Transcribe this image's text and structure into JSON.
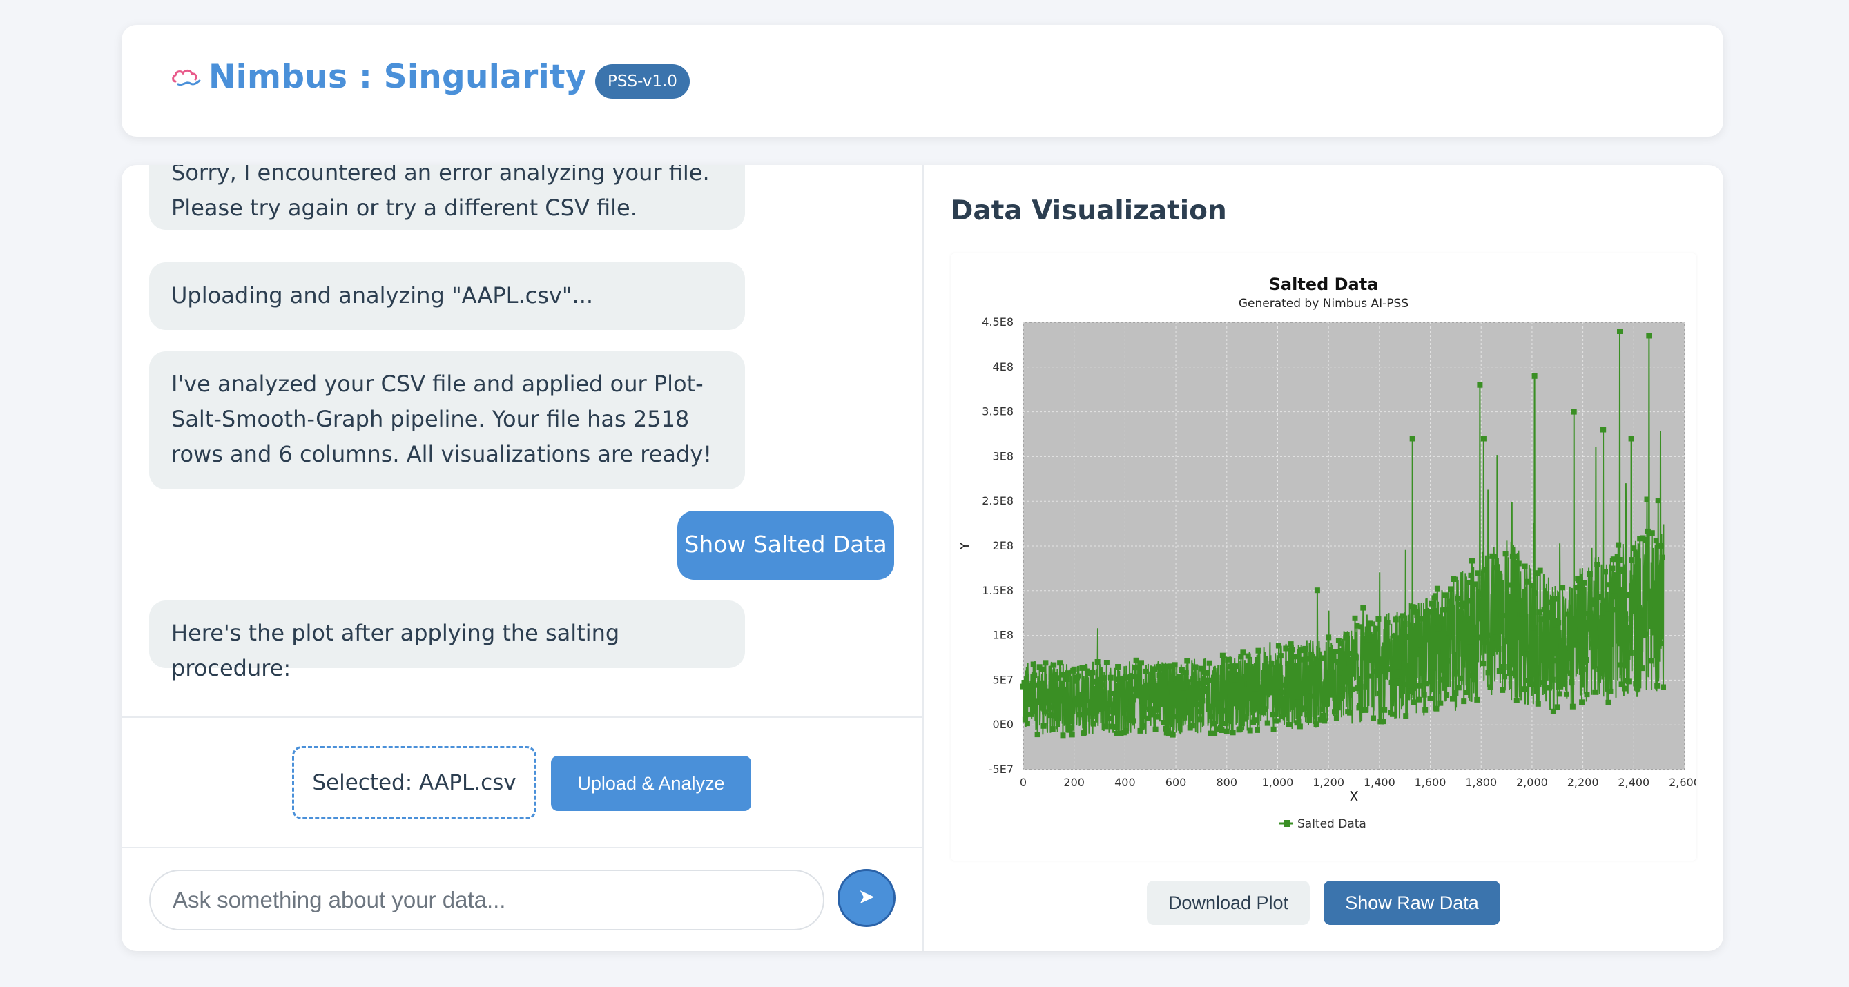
{
  "header": {
    "title": "Nimbus : Singularity",
    "version": "PSS-v1.0",
    "logo_icon": "cloud-icon"
  },
  "chat": {
    "messages": [
      {
        "role": "bot",
        "text": "Sorry, I encountered an error analyzing your file. Please try again or try a different CSV file."
      },
      {
        "role": "bot",
        "text": "Uploading and analyzing \"AAPL.csv\"..."
      },
      {
        "role": "bot",
        "text": "I've analyzed your CSV file and applied our Plot-Salt-Smooth-Graph pipeline. Your file has 2518 rows and 6 columns. All visualizations are ready!"
      },
      {
        "role": "user",
        "text": "Show Salted Data"
      },
      {
        "role": "bot",
        "text": "Here's the plot after applying the salting procedure:"
      }
    ],
    "selected_file": "Selected: AAPL.csv",
    "upload_label": "Upload & Analyze",
    "input_placeholder": "Ask something about your data...",
    "send_icon": "send-arrow-icon"
  },
  "viz": {
    "title": "Data Visualization",
    "download_label": "Download Plot",
    "raw_label": "Show Raw Data"
  },
  "colors": {
    "accent": "#4a90d9",
    "badge": "#3b74ad",
    "series": "#3a8f24",
    "plot_bg": "#c0c0c0"
  },
  "chart_data": {
    "type": "line",
    "title": "Salted Data",
    "subtitle": "Generated by Nimbus AI-PSS",
    "xlabel": "X",
    "ylabel": "Y",
    "xlim": [
      0,
      2600
    ],
    "ylim": [
      -50000000,
      450000000
    ],
    "x_ticks": [
      "0",
      "200",
      "400",
      "600",
      "800",
      "1,000",
      "1,200",
      "1,400",
      "1,600",
      "1,800",
      "2,000",
      "2,200",
      "2,400",
      "2,600"
    ],
    "y_ticks": [
      "4.5E8",
      "4E8",
      "3.5E8",
      "3E8",
      "2.5E8",
      "2E8",
      "1.5E8",
      "1E8",
      "5E7",
      "0E0",
      "-5E7"
    ],
    "legend": "bottom",
    "grid": true,
    "series": [
      {
        "name": "Salted Data",
        "n_points": 2518,
        "x": [
          0,
          100,
          200,
          300,
          400,
          500,
          600,
          700,
          800,
          900,
          1000,
          1100,
          1200,
          1300,
          1400,
          1500,
          1600,
          1700,
          1800,
          1900,
          2000,
          2100,
          2200,
          2300,
          2400,
          2500
        ],
        "trend": [
          30000000,
          30000000,
          28000000,
          30000000,
          32000000,
          32000000,
          30000000,
          32000000,
          35000000,
          38000000,
          42000000,
          45000000,
          50000000,
          55000000,
          62000000,
          70000000,
          80000000,
          90000000,
          110000000,
          120000000,
          100000000,
          85000000,
          100000000,
          110000000,
          120000000,
          130000000
        ],
        "spikes": [
          {
            "x": 1530,
            "y": 320000000
          },
          {
            "x": 1795,
            "y": 380000000
          },
          {
            "x": 1810,
            "y": 320000000
          },
          {
            "x": 2010,
            "y": 390000000
          },
          {
            "x": 2165,
            "y": 350000000
          },
          {
            "x": 2280,
            "y": 330000000
          },
          {
            "x": 2345,
            "y": 440000000
          },
          {
            "x": 2460,
            "y": 435000000
          },
          {
            "x": 2390,
            "y": 320000000
          }
        ]
      }
    ]
  }
}
